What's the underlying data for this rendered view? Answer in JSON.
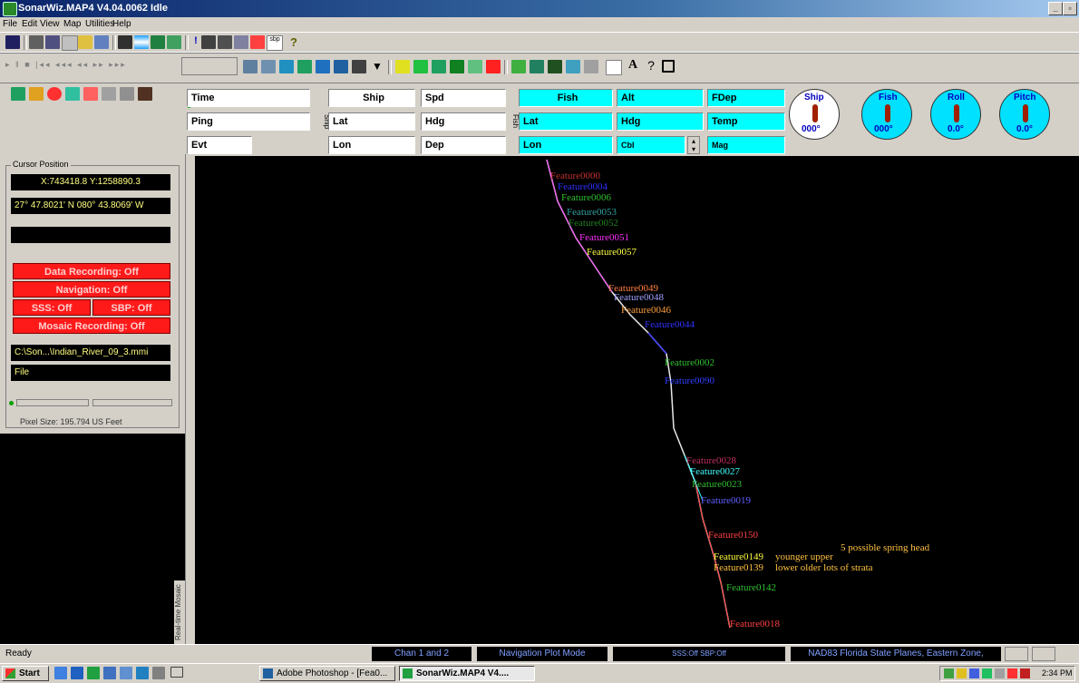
{
  "window": {
    "title": "SonarWiz.MAP4 V4.04.0062 Idle"
  },
  "menu": [
    "File",
    "Edit",
    "View",
    "Map",
    "Utilities",
    "Help"
  ],
  "readouts": {
    "time_label": "Time",
    "ping_label": "Ping",
    "evt_label": "Evt",
    "ship_label": "Ship",
    "ship_lat": "Lat",
    "ship_lon": "Lon",
    "spd_label": "Spd",
    "hdg_label": "Hdg",
    "dep_label": "Dep",
    "fish_label": "Fish",
    "fish_lat": "Lat",
    "fish_lon": "Lon",
    "alt_label": "Alt",
    "fish_hdg": "Hdg",
    "cbl_label": "Cbl",
    "fdep_label": "FDep",
    "temp_label": "Temp",
    "mag_label": "Mag"
  },
  "gauges": [
    {
      "name": "Ship",
      "value": "000°",
      "face": "#ffffff"
    },
    {
      "name": "Fish",
      "value": "000°",
      "face": "#00e0ff"
    },
    {
      "name": "Roll",
      "value": "0.0°",
      "face": "#00e0ff"
    },
    {
      "name": "Pitch",
      "value": "0.0°",
      "face": "#00e0ff"
    }
  ],
  "left_panel": {
    "cursor_group": "Cursor Position",
    "xy": "X:743418.8 Y:1258890.3",
    "latlon": "27° 47.8021' N 080° 43.8069' W",
    "data_recording": "Data Recording: Off",
    "navigation": "Navigation: Off",
    "sss": "SSS: Off",
    "sbp": "SBP: Off",
    "mosaic_recording": "Mosaic Recording: Off",
    "file_path": "C:\\Son...\\Indian_River_09_3.mmi",
    "file_label": "File",
    "pixel_size": "Pixel Size: 195.794 US Feet",
    "mosaic_label": "Real-time Mosaic"
  },
  "map_features": [
    {
      "text": "Feature0000",
      "color": "#c03030"
    },
    {
      "text": "Feature0004",
      "color": "#3030ff"
    },
    {
      "text": "Feature0006",
      "color": "#30c030"
    },
    {
      "text": "Feature0053",
      "color": "#30a0a0"
    },
    {
      "text": "Feature0052",
      "color": "#208020"
    },
    {
      "text": "Feature0051",
      "color": "#ff30ff"
    },
    {
      "text": "Feature0057",
      "color": "#ffff40"
    },
    {
      "text": "Feature0049",
      "color": "#ff8040"
    },
    {
      "text": "Feature0048",
      "color": "#a0a0ff"
    },
    {
      "text": "Feature0046",
      "color": "#ffa040"
    },
    {
      "text": "Feature0044",
      "color": "#3030ff"
    },
    {
      "text": "Feature0002",
      "color": "#30c030"
    },
    {
      "text": "Feature0090",
      "color": "#3040ff"
    },
    {
      "text": "Feature0028",
      "color": "#c03060"
    },
    {
      "text": "Feature0027",
      "color": "#40ffff"
    },
    {
      "text": "Feature0023",
      "color": "#30c030"
    },
    {
      "text": "Feature0019",
      "color": "#6060ff"
    },
    {
      "text": "Feature0150",
      "color": "#ff4040"
    },
    {
      "text": "Feature0149",
      "color": "#ffff40"
    },
    {
      "text": "Feature0139",
      "color": "#ffc040"
    },
    {
      "text": "Feature0142",
      "color": "#30c030"
    },
    {
      "text": "Feature0018",
      "color": "#ff4040"
    }
  ],
  "annotations": {
    "spring": "5 possible spring head",
    "younger": "younger upper",
    "older": "lower older lots of strata"
  },
  "status": {
    "ready": "Ready",
    "chan": "Chan 1 and 2",
    "mode": "Navigation Plot Mode",
    "sss_sbp": "SSS:Off   SBP:Off",
    "projection": "NAD83 Florida State Planes, Eastern Zone,"
  },
  "taskbar": {
    "start": "Start",
    "task1": "Adobe Photoshop - [Fea0...",
    "task2": "SonarWiz.MAP4 V4....",
    "clock": "2:34 PM"
  }
}
